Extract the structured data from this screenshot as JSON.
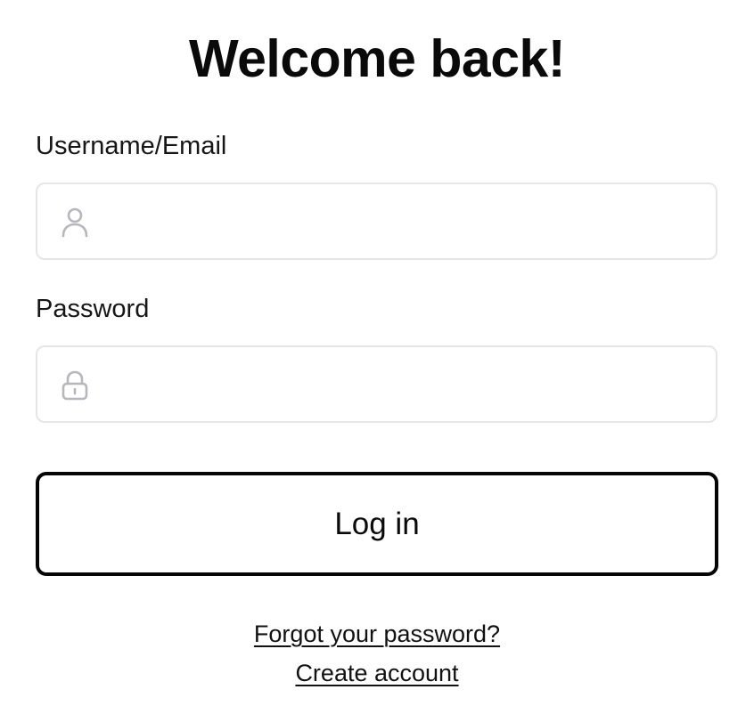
{
  "page": {
    "title": "Welcome back!"
  },
  "form": {
    "username": {
      "label": "Username/Email",
      "value": "",
      "placeholder": "",
      "icon": "user-icon"
    },
    "password": {
      "label": "Password",
      "value": "",
      "placeholder": "",
      "icon": "lock-icon"
    },
    "submit_label": "Log in"
  },
  "links": {
    "forgot_password": "Forgot your password?",
    "create_account": "Create account"
  },
  "colors": {
    "border": "#e6e6e8",
    "icon": "#b6b6bd",
    "button_border": "#050505",
    "text": "#111111"
  }
}
